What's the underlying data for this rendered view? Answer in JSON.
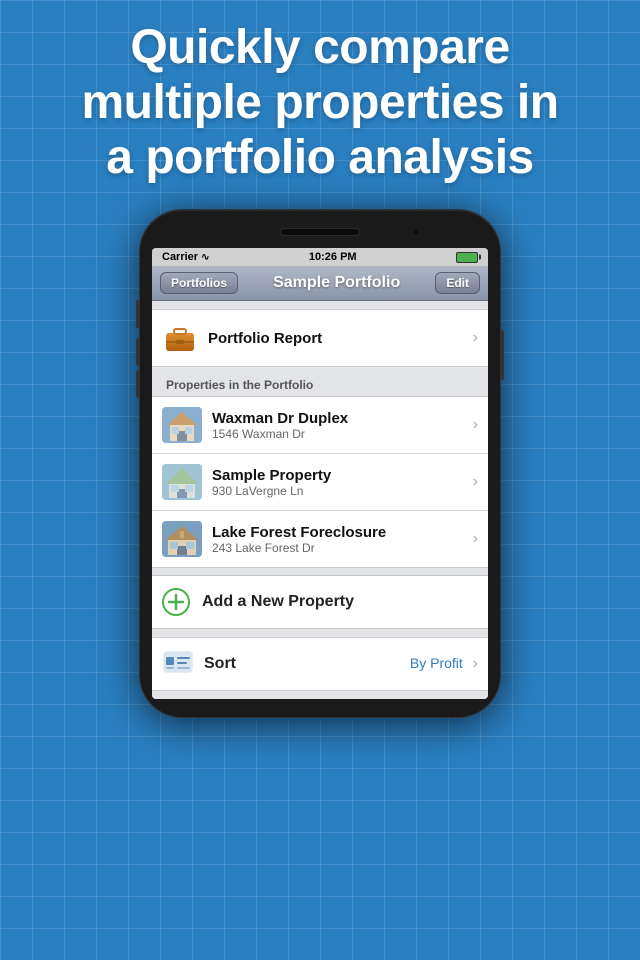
{
  "background": {
    "color": "#2a7fc1"
  },
  "hero": {
    "line1": "Quickly compare",
    "line2": "multiple properties in",
    "line3": "a portfolio analysis"
  },
  "status_bar": {
    "carrier": "Carrier",
    "time": "10:26 PM"
  },
  "nav": {
    "back_label": "Portfolios",
    "title": "Sample Portfolio",
    "edit_label": "Edit"
  },
  "portfolio_report_row": {
    "title": "Portfolio Report"
  },
  "section_header": "Properties in the Portfolio",
  "properties": [
    {
      "name": "Waxman Dr Duplex",
      "address": "1546 Waxman Dr",
      "color": "#8aafcf"
    },
    {
      "name": "Sample Property",
      "address": "930 LaVergne Ln",
      "color": "#9abfcf"
    },
    {
      "name": "Lake Forest Foreclosure",
      "address": "243 Lake Forest Dr",
      "color": "#7a9fbf"
    }
  ],
  "add_property": {
    "label": "Add a New Property",
    "icon": "+"
  },
  "sort_row": {
    "label": "Sort",
    "value": "By Profit",
    "full_label": "Sort By Profit"
  }
}
